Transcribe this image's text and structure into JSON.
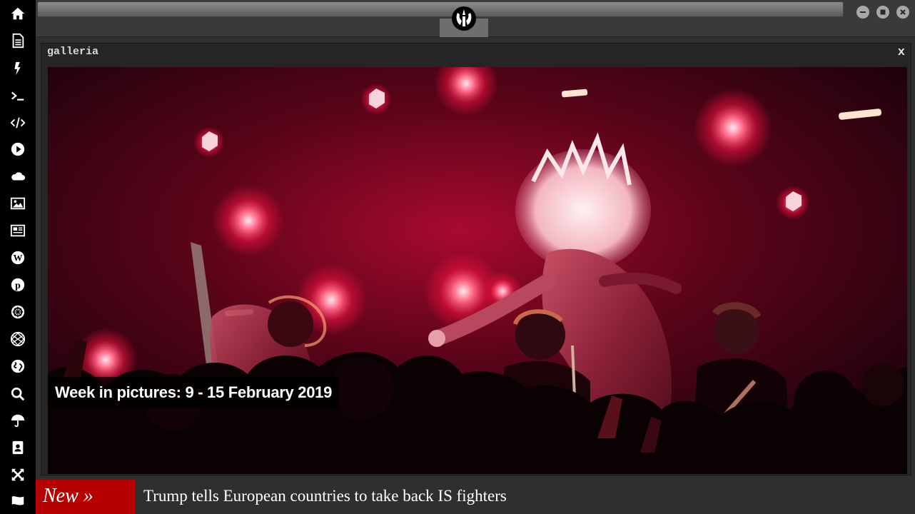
{
  "sidebar": {
    "icons": [
      "home-icon",
      "document-icon",
      "lightning-icon",
      "terminal-icon",
      "code-icon",
      "play-icon",
      "cloud-icon",
      "image-icon",
      "newspaper-icon",
      "wordpress-icon",
      "pinterest-icon",
      "rebel-icon",
      "empire-icon",
      "globe-icon",
      "search-icon",
      "umbrella-icon",
      "contact-icon",
      "expand-icon",
      "flag-icon"
    ]
  },
  "window_controls": [
    "minimize-icon",
    "maximize-icon",
    "close-icon"
  ],
  "panel": {
    "title": "galleria",
    "close_label": "x",
    "caption": "Week in pictures: 9 - 15 February 2019"
  },
  "ticker": {
    "badge": "New »",
    "headline": "Trump tells European countries to take back IS fighters"
  },
  "colors": {
    "sidebar_bg": "#000000",
    "badge_red": "#b70000",
    "stage_red": "#d0103a"
  }
}
